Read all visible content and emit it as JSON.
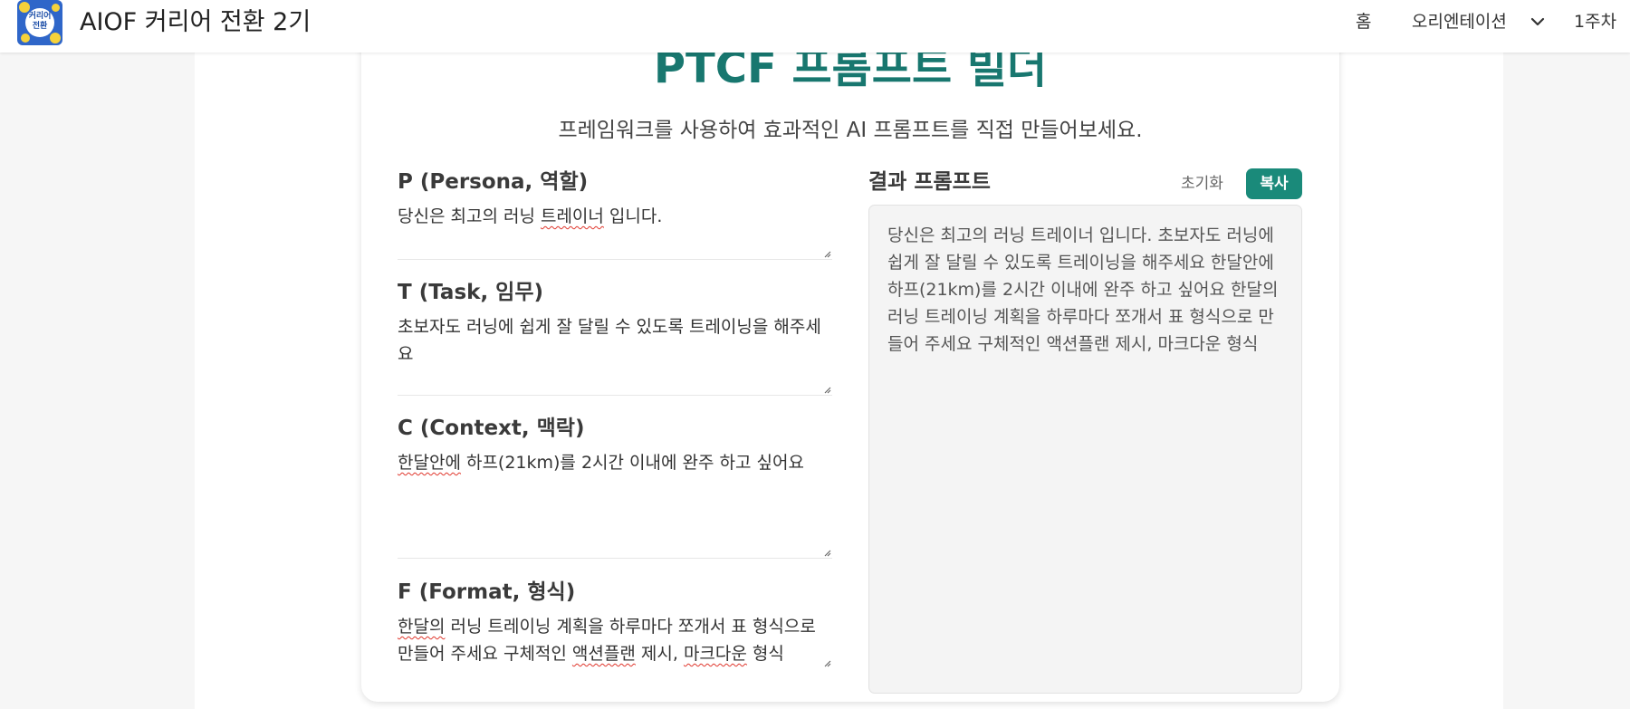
{
  "header": {
    "logo_text": "커리어 전환",
    "site_title": "AIOF 커리어 전환 2기",
    "nav": {
      "home": "홈",
      "orientation": "오리엔테이션",
      "week1": "1주차"
    }
  },
  "main": {
    "title": "PTCF 프롬프트 빌더",
    "subtitle": "프레임워크를 사용하여 효과적인 AI 프롬프트를 직접 만들어보세요.",
    "fields": [
      {
        "label": "P (Persona, 역할)",
        "value": "당신은 최고의 러닝 트레이너 입니다."
      },
      {
        "label": "T (Task, 임무)",
        "value": "초보자도 러닝에 쉽게 잘 달릴 수 있도록 트레이닝을 해주세요"
      },
      {
        "label": "C (Context, 맥락)",
        "value": "한달안에 하프(21km)를 2시간 이내에 완주 하고 싶어요"
      },
      {
        "label": "F (Format, 형식)",
        "value": "한달의 러닝 트레이닝 계획을 하루마다 쪼개서 표 형식으로 만들어 주세요 구체적인 액션플랜 제시, 마크다운 형식"
      }
    ],
    "result": {
      "label": "결과 프롬프트",
      "reset_label": "초기화",
      "copy_label": "복사",
      "text": "당신은 최고의 러닝 트레이너 입니다. 초보자도 러닝에 쉽게 잘 달릴 수 있도록 트레이닝을 해주세요 한달안에 하프(21km)를 2시간 이내에 완주 하고 싶어요 한달의 러닝 트레이닝 계획을 하루마다 쪼개서 표 형식으로 만들어 주세요 구체적인 액션플랜 제시, 마크다운 형식"
    }
  },
  "colors": {
    "accent": "#18776f",
    "copy_button": "#1a8a7a",
    "spellcheck": "#e0362c"
  },
  "icons": [
    "chevron-down-icon",
    "resize-handle-icon"
  ]
}
